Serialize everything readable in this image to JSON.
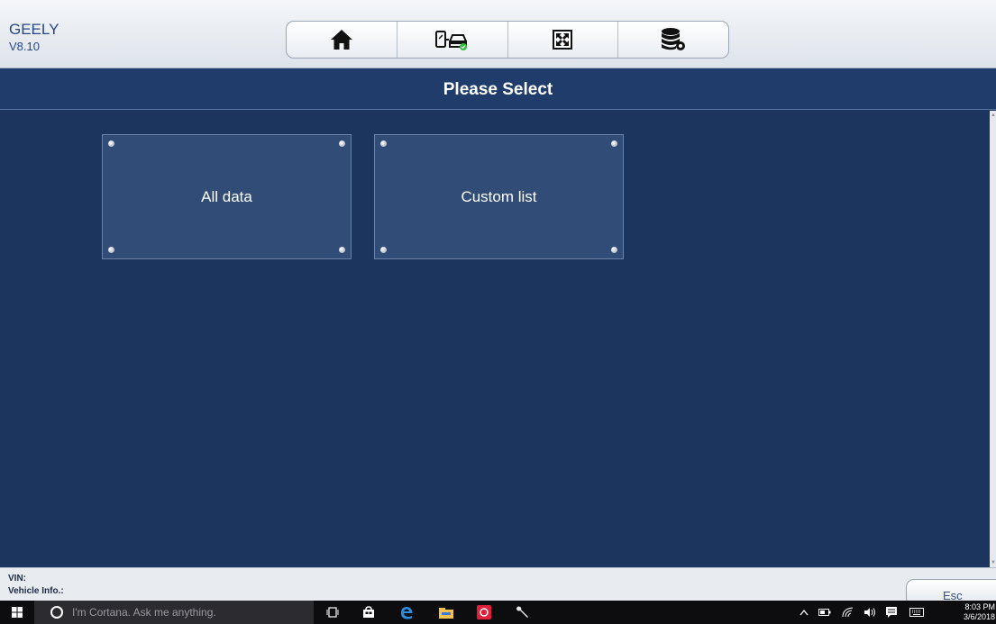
{
  "app": {
    "brand": "GEELY",
    "version": "V8.10"
  },
  "toolbar": {
    "buttons": [
      {
        "icon": "home-icon"
      },
      {
        "icon": "vehicle-connect-icon"
      },
      {
        "icon": "fullscreen-icon"
      },
      {
        "icon": "database-settings-icon"
      }
    ]
  },
  "title": "Please Select",
  "tiles": [
    {
      "label": "All data"
    },
    {
      "label": "Custom list"
    }
  ],
  "footer": {
    "vin_label": "VIN:",
    "vehicle_info_label": "Vehicle Info.:",
    "esc_label": "Esc"
  },
  "taskbar": {
    "search_placeholder": "I'm Cortana. Ask me anything.",
    "time": "8:03 PM",
    "date": "3/6/2018"
  },
  "colors": {
    "background": "#1b355f",
    "tile": "#314c77",
    "brand": "#27468a",
    "badge_green": "#2fbf3a"
  }
}
